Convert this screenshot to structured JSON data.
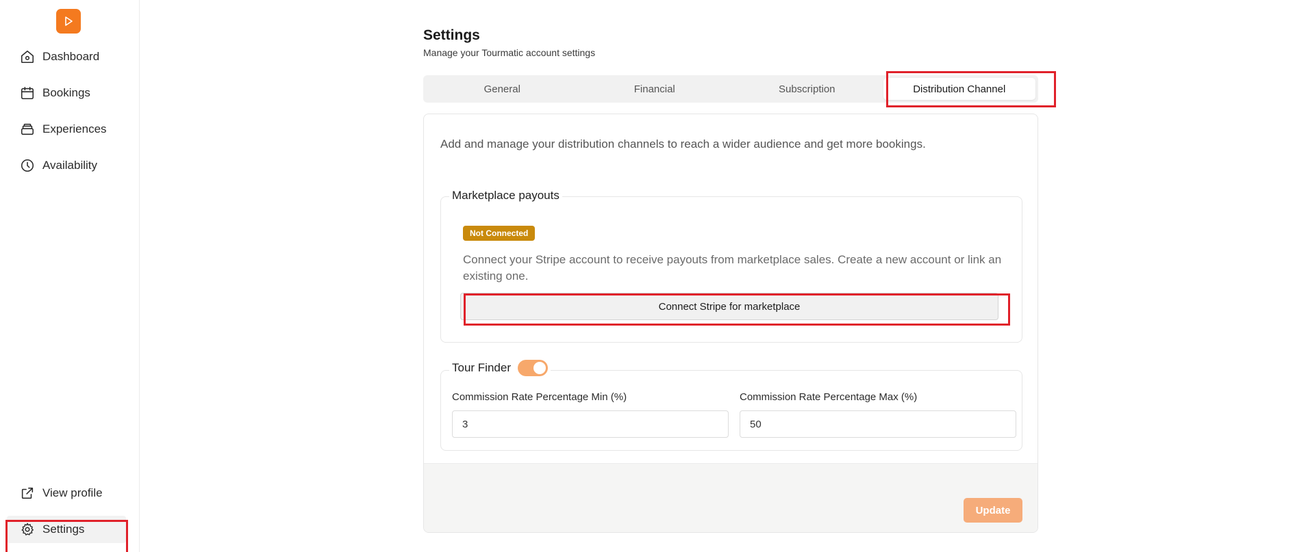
{
  "sidebar": {
    "logo_icon": "play-icon",
    "items": [
      {
        "label": "Dashboard",
        "icon": "home-icon"
      },
      {
        "label": "Bookings",
        "icon": "calendar-icon"
      },
      {
        "label": "Experiences",
        "icon": "layers-icon"
      },
      {
        "label": "Availability",
        "icon": "clock-icon"
      }
    ],
    "bottom_items": [
      {
        "label": "View profile",
        "icon": "external-link-icon"
      },
      {
        "label": "Settings",
        "icon": "gear-icon",
        "active": true
      }
    ]
  },
  "header": {
    "title": "Settings",
    "subtitle": "Manage your Tourmatic account settings"
  },
  "tabs": [
    {
      "label": "General"
    },
    {
      "label": "Financial"
    },
    {
      "label": "Subscription"
    },
    {
      "label": "Distribution Channel",
      "active": true
    }
  ],
  "distribution": {
    "description": "Add and manage your distribution channels to reach a wider audience and get more bookings.",
    "marketplace": {
      "legend": "Marketplace payouts",
      "status_badge": "Not Connected",
      "text": "Connect your Stripe account to receive payouts from marketplace sales. Create a new account or link an existing one.",
      "button_label": "Connect Stripe for marketplace"
    },
    "tour_finder": {
      "legend": "Tour Finder",
      "enabled": true,
      "min_label": "Commission Rate Percentage Min (%)",
      "min_value": "3",
      "max_label": "Commission Rate Percentage Max (%)",
      "max_value": "50"
    },
    "update_label": "Update"
  },
  "colors": {
    "accent": "#f47a1f",
    "badge": "#c98a0c",
    "highlight": "#e0212a",
    "toggle_on": "#f7a86b"
  }
}
